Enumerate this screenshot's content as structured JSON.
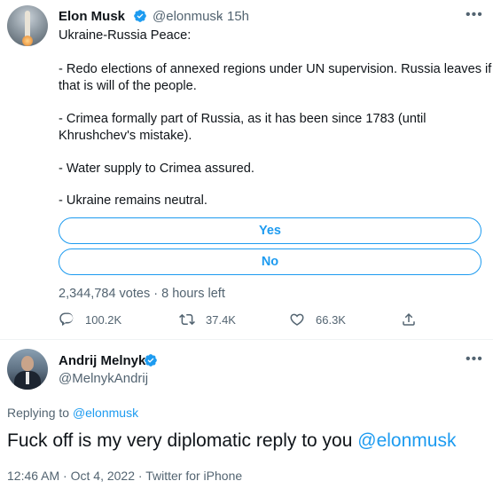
{
  "tweet": {
    "author_name": "Elon Musk",
    "author_handle": "@elonmusk",
    "time_sep": "·",
    "time": "15h",
    "more": "•••",
    "lines": [
      "Ukraine-Russia Peace:",
      "- Redo elections of annexed regions under UN supervision. Russia leaves if",
      "that is will of the people.",
      "- Crimea formally part of Russia, as it has been since 1783 (until",
      "Khrushchev's mistake).",
      "- Water supply to Crimea assured.",
      "- Ukraine remains neutral."
    ],
    "poll": {
      "options": [
        "Yes",
        "No"
      ],
      "votes": "2,344,784 votes",
      "sep": "·",
      "time_left": "8 hours left"
    },
    "actions": {
      "replies": "100.2K",
      "retweets": "37.4K",
      "likes": "66.3K"
    }
  },
  "reply": {
    "author_name": "Andrij Melnyk",
    "author_handle": "@MelnykAndrij",
    "more": "•••",
    "replying_prefix": "Replying to",
    "replying_to": "@elonmusk",
    "text_main": "Fuck off is my very diplomatic reply to you",
    "text_mention": "@elonmusk",
    "time": "12:46 AM",
    "date": "Oct 4, 2022",
    "source": "Twitter for iPhone",
    "sep": "·"
  },
  "colors": {
    "accent": "#1d9bf0",
    "muted": "#536471",
    "text": "#0f1419"
  }
}
